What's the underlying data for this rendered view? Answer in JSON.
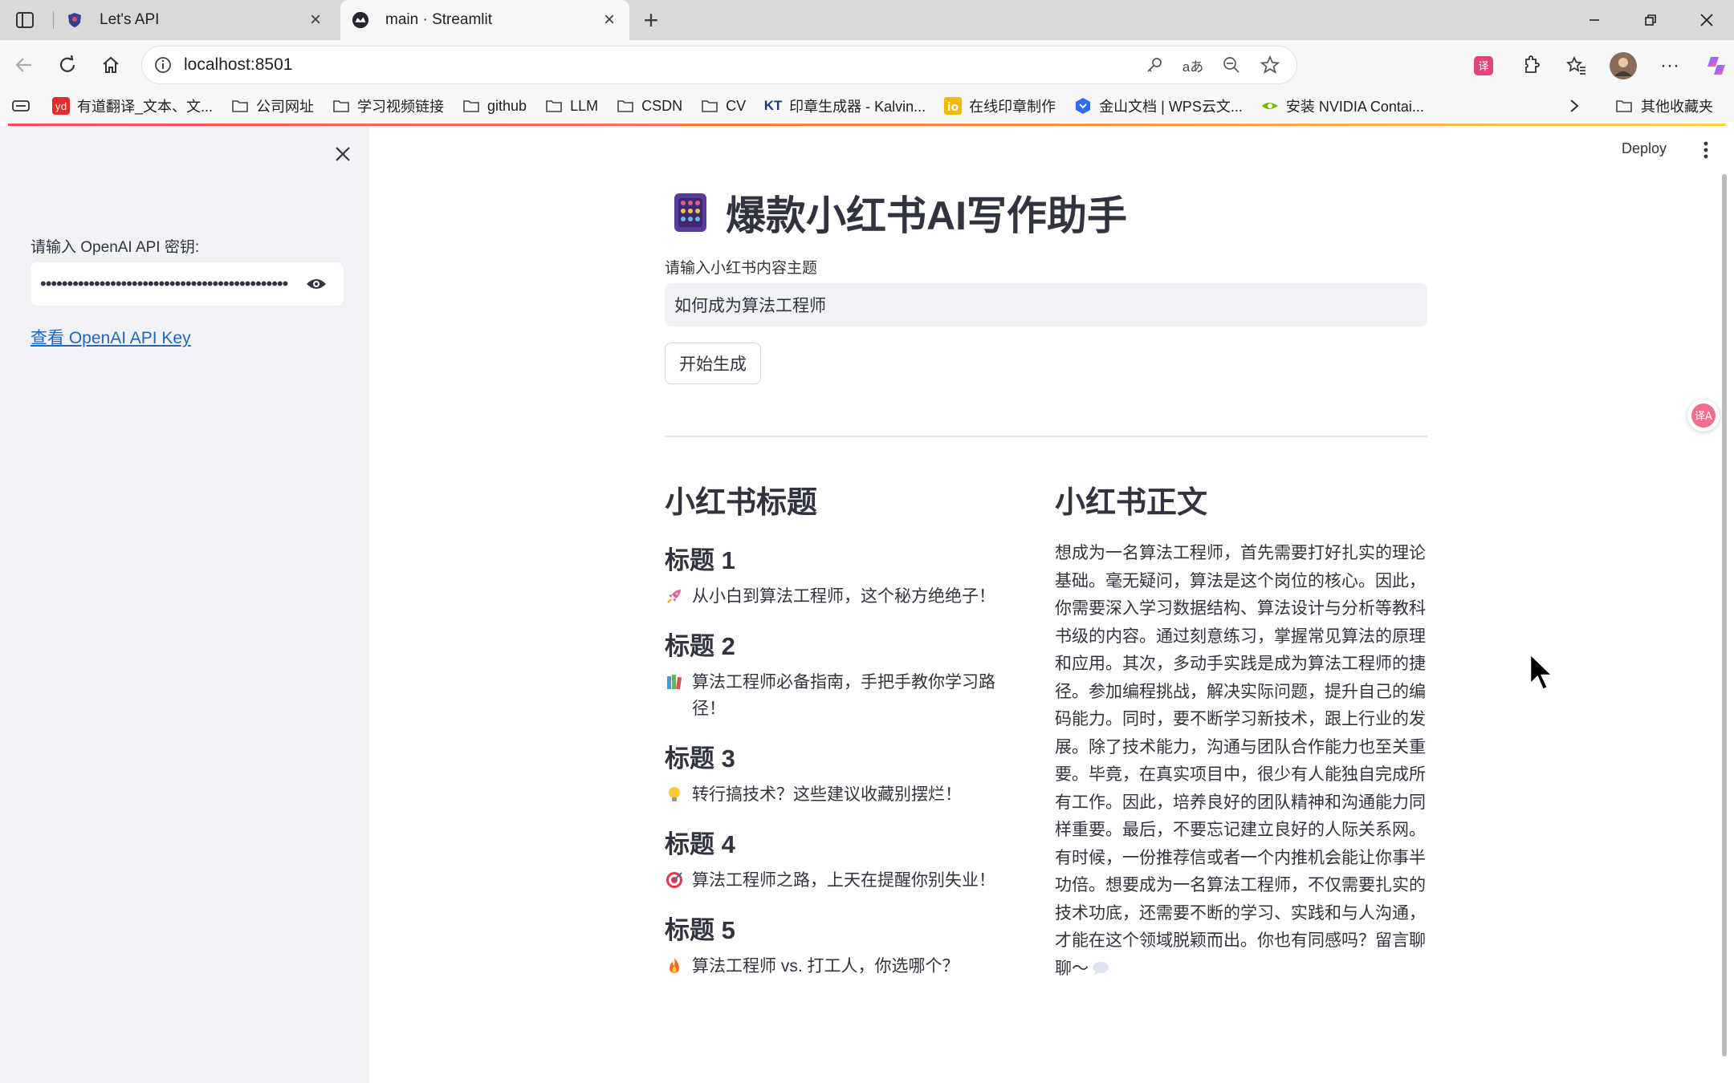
{
  "browser": {
    "tabs": [
      {
        "title": "Let's API",
        "active": false
      },
      {
        "title": "main · Streamlit",
        "active": true
      }
    ],
    "address": "localhost:8501",
    "bookmarks": [
      {
        "label": "有道翻译_文本、文...",
        "icon": "youdao-icon"
      },
      {
        "label": "公司网址",
        "icon": "folder-icon"
      },
      {
        "label": "学习视频链接",
        "icon": "folder-icon"
      },
      {
        "label": "github",
        "icon": "folder-icon"
      },
      {
        "label": "LLM",
        "icon": "folder-icon"
      },
      {
        "label": "CSDN",
        "icon": "folder-icon"
      },
      {
        "label": "CV",
        "icon": "folder-icon"
      },
      {
        "label": "印章生成器 - Kalvin...",
        "icon": "kt-icon"
      },
      {
        "label": "在线印章制作",
        "icon": "io-icon"
      },
      {
        "label": "金山文档 | WPS云文...",
        "icon": "wps-icon"
      },
      {
        "label": "安装 NVIDIA Contai...",
        "icon": "nvidia-icon"
      }
    ],
    "other_bookmarks": "其他收藏夹"
  },
  "sidebar": {
    "api_label": "请输入 OpenAI API 密钥:",
    "api_value": "••••••••••••••••••••••••••••••••••••••••••••••",
    "link_text": "查看 OpenAI API Key"
  },
  "header": {
    "deploy": "Deploy"
  },
  "main": {
    "title": "爆款小红书AI写作助手",
    "topic_label": "请输入小红书内容主题",
    "topic_value": "如何成为算法工程师",
    "button": "开始生成",
    "titles_heading": "小红书标题",
    "titles": [
      {
        "heading": "标题 1",
        "emoji": "rocket",
        "text": "从小白到算法工程师，这个秘方绝绝子！"
      },
      {
        "heading": "标题 2",
        "emoji": "books",
        "text": "算法工程师必备指南，手把手教你学习路径！"
      },
      {
        "heading": "标题 3",
        "emoji": "bulb",
        "text": "转行搞技术？这些建议收藏别摆烂！"
      },
      {
        "heading": "标题 4",
        "emoji": "target",
        "text": "算法工程师之路，上天在提醒你别失业！"
      },
      {
        "heading": "标题 5",
        "emoji": "fire",
        "text": "算法工程师 vs. 打工人，你选哪个？"
      }
    ],
    "body_heading": "小红书正文",
    "body": "想成为一名算法工程师，首先需要打好扎实的理论基础。毫无疑问，算法是这个岗位的核心。因此，你需要深入学习数据结构、算法设计与分析等教科书级的内容。通过刻意练习，掌握常见算法的原理和应用。其次，多动手实践是成为算法工程师的捷径。参加编程挑战，解决实际问题，提升自己的编码能力。同时，要不断学习新技术，跟上行业的发展。除了技术能力，沟通与团队合作能力也至关重要。毕竟，在真实项目中，很少有人能独自完成所有工作。因此，培养良好的团队精神和沟通能力同样重要。最后，不要忘记建立良好的人际关系网。有时候，一份推荐信或者一个内推机会能让你事半功倍。想要成为一名算法工程师，不仅需要扎实的技术功底，还需要不断的学习、实践和与人沟通，才能在这个领域脱颖而出。你也有同感吗？留言聊聊～"
  }
}
